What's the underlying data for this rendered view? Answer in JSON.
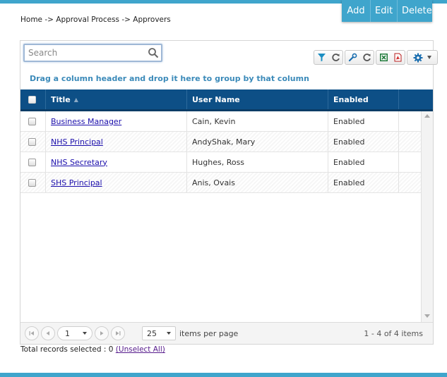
{
  "actions": {
    "add": "Add",
    "edit": "Edit",
    "delete": "Delete"
  },
  "breadcrumb": "Home -> Approval Process -> Approvers",
  "search": {
    "placeholder": "Search",
    "value": ""
  },
  "toolbar": {
    "icons": [
      "filter-icon",
      "refresh-icon",
      "wrench-icon",
      "refresh-icon",
      "excel-icon",
      "pdf-icon",
      "gear-icon",
      "caret-down-icon"
    ]
  },
  "group_hint": "Drag a column header and drop it here to group by that column",
  "columns": {
    "title": "Title",
    "user_name": "User Name",
    "enabled": "Enabled"
  },
  "rows": [
    {
      "title": "Business Manager",
      "user_name": "Cain, Kevin",
      "enabled": "Enabled"
    },
    {
      "title": "NHS Principal",
      "user_name": "AndyShak, Mary",
      "enabled": "Enabled"
    },
    {
      "title": "NHS Secretary",
      "user_name": "Hughes, Ross",
      "enabled": "Enabled"
    },
    {
      "title": "SHS Principal",
      "user_name": "Anis, Ovais",
      "enabled": "Enabled"
    }
  ],
  "pager": {
    "page": "1",
    "page_size": "25",
    "items_per_page_label": "items per page",
    "range": "1 - 4 of 4 items"
  },
  "selection": {
    "label": "Total records selected : 0",
    "unselect": "(Unselect All)"
  },
  "colors": {
    "accent": "#3fa5cc",
    "header": "#0d4f86",
    "hint": "#3b8ab9"
  }
}
